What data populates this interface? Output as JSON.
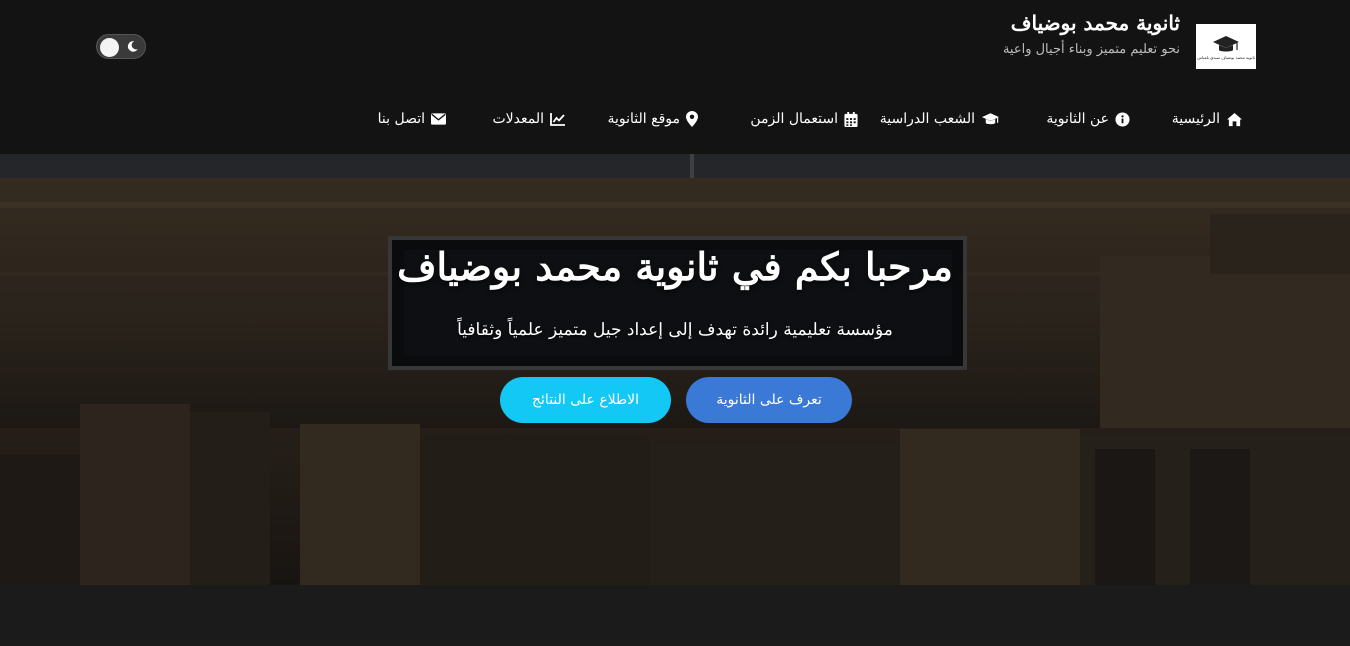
{
  "header": {
    "title": "ثانوية محمد بوضياف",
    "subtitle": "نحو تعليم متميز وبناء أجيال واعية",
    "logo_text": "ثانوية محمد بوضياف سيدي بلعباس"
  },
  "theme_toggle": {
    "state": "off",
    "icon": "moon-icon"
  },
  "nav": {
    "items": [
      {
        "label": "الرئيسية",
        "icon": "home-icon"
      },
      {
        "label": "عن الثانوية",
        "icon": "info-circle-icon"
      },
      {
        "label": "الشعب الدراسية",
        "icon": "graduation-cap-icon"
      },
      {
        "label": "استعمال الزمن",
        "icon": "calendar-icon"
      },
      {
        "label": "موقع الثانوية",
        "icon": "map-marker-icon"
      },
      {
        "label": "المعدلات",
        "icon": "chart-line-icon"
      },
      {
        "label": "اتصل بنا",
        "icon": "envelope-icon"
      }
    ]
  },
  "hero": {
    "title": "مرحبا بكم في ثانوية محمد بوضياف",
    "subtitle": "مؤسسة تعليمية رائدة تهدف إلى إعداد جيل متميز علمياً وثقافياً",
    "primary_button": "تعرف على الثانوية",
    "secondary_button": "الاطلاع على النتائج"
  },
  "colors": {
    "header_bg": "#131313",
    "primary_button": "#3a79d6",
    "secondary_button": "#13c8f5"
  }
}
